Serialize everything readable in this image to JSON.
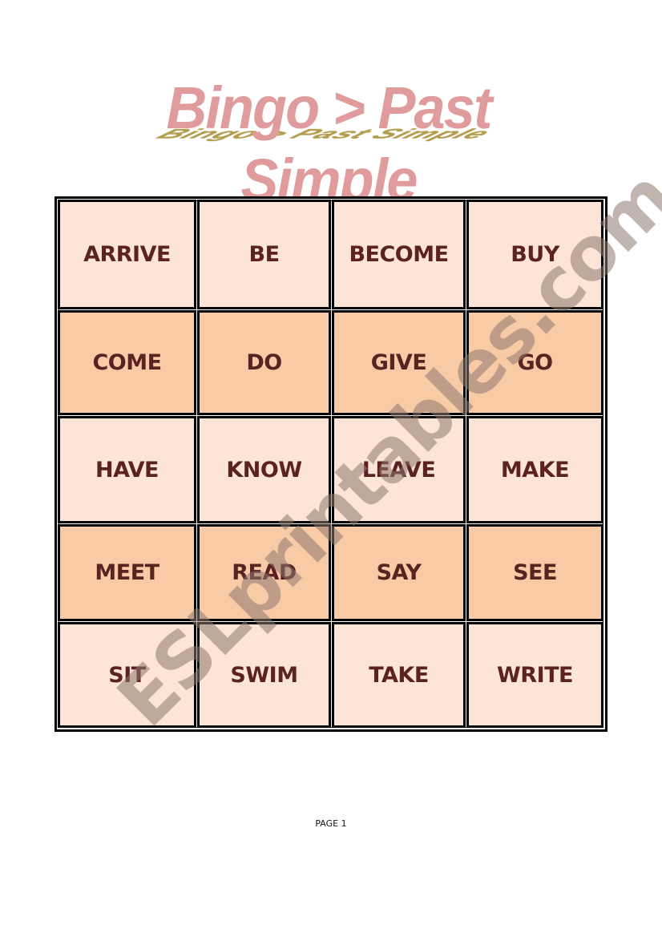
{
  "title": "Bingo > Past Simple",
  "title_reflection": "Bingo > Past Simple",
  "bingo": {
    "columns": 4,
    "rows": [
      {
        "shade": "light",
        "words": [
          "ARRIVE",
          "BE",
          "BECOME",
          "BUY"
        ]
      },
      {
        "shade": "dark",
        "words": [
          "COME",
          "DO",
          "GIVE",
          "GO"
        ]
      },
      {
        "shade": "light",
        "words": [
          "HAVE",
          "KNOW",
          "LEAVE",
          "MAKE"
        ]
      },
      {
        "shade": "dark",
        "words": [
          "MEET",
          "READ",
          "SAY",
          "SEE"
        ]
      },
      {
        "shade": "light",
        "words": [
          "SIT",
          "SWIM",
          "TAKE",
          "WRITE"
        ]
      }
    ]
  },
  "colors": {
    "cell_light": "#fce4d6",
    "cell_dark": "#f8cba6",
    "word_text": "#5c2222",
    "title_fill": "#e09c9c",
    "title_reflection": "#a88c2a"
  },
  "watermark": "ESLprintables.com",
  "footer": {
    "page_label": "PAGE 1"
  }
}
